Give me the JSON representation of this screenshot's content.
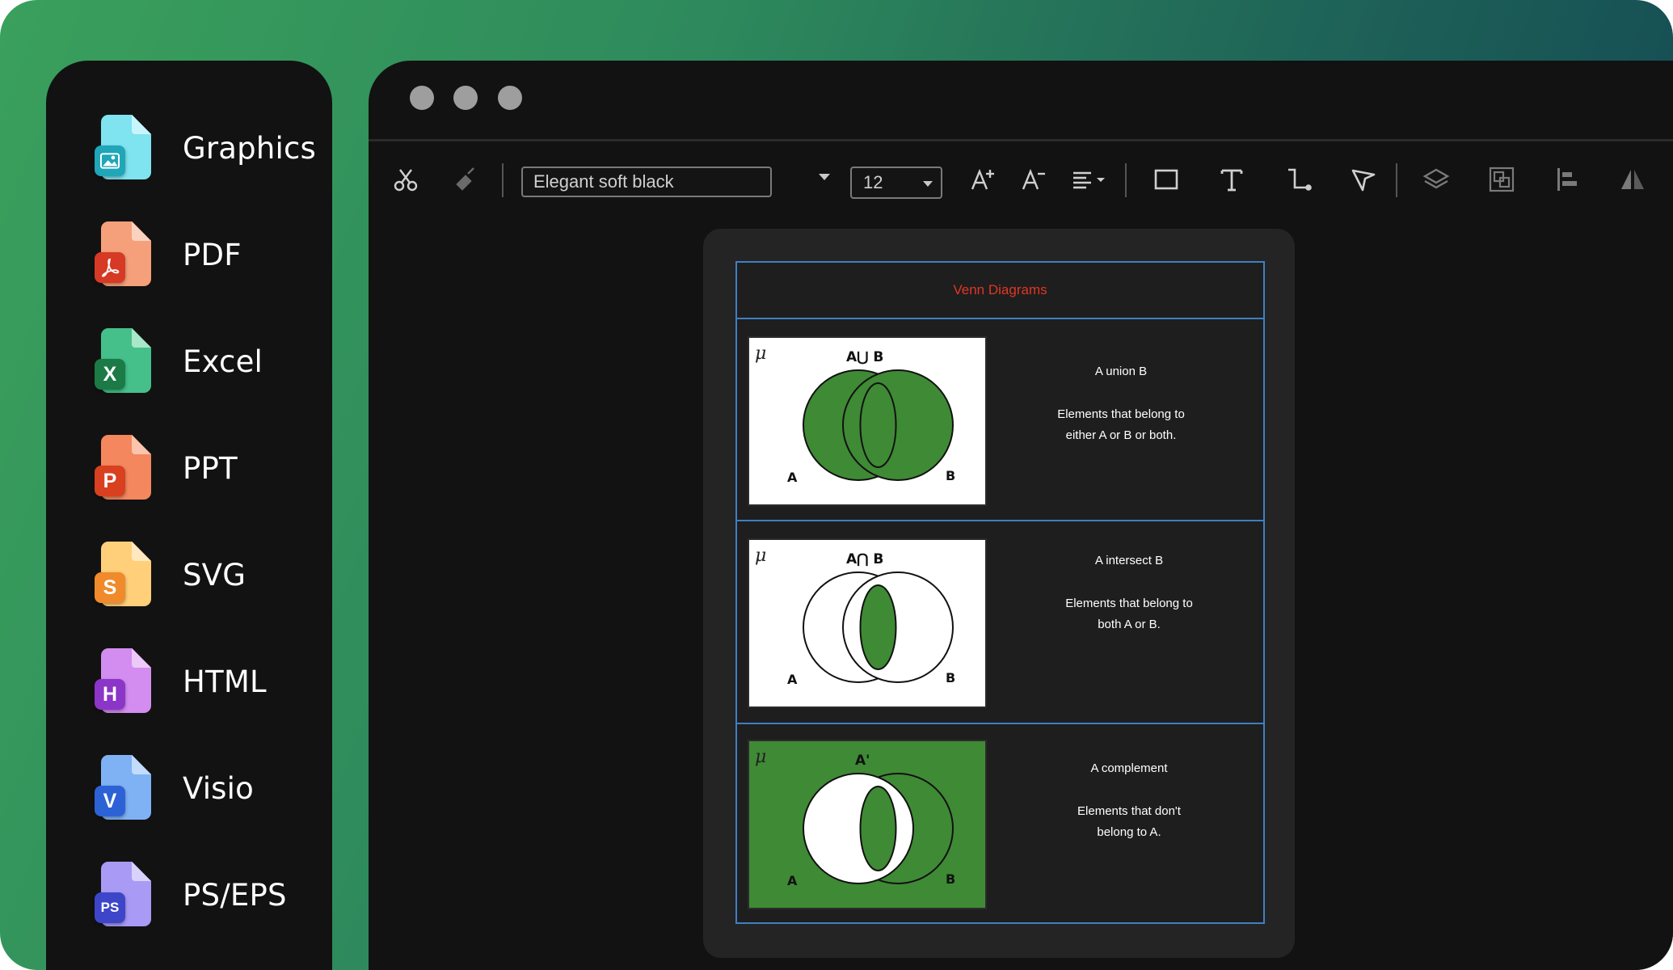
{
  "sidebar": {
    "items": [
      {
        "label": "Graphics",
        "badge": "",
        "icon": "image-file-icon",
        "sheet": "#7fe3f0",
        "fold": "#c8f5fb",
        "badge_color": "#1fa6b8"
      },
      {
        "label": "PDF",
        "badge": "",
        "icon": "pdf-file-icon",
        "sheet": "#f5a07a",
        "fold": "#fbd2bf",
        "badge_color": "#d63a24"
      },
      {
        "label": "Excel",
        "badge": "X",
        "icon": "excel-file-icon",
        "sheet": "#45c08a",
        "fold": "#a8e7c9",
        "badge_color": "#1b7a45"
      },
      {
        "label": "PPT",
        "badge": "P",
        "icon": "ppt-file-icon",
        "sheet": "#f4875e",
        "fold": "#fbc4ad",
        "badge_color": "#d9401f"
      },
      {
        "label": "SVG",
        "badge": "S",
        "icon": "svg-file-icon",
        "sheet": "#ffcf7a",
        "fold": "#ffe8bf",
        "badge_color": "#f08a2b"
      },
      {
        "label": "HTML",
        "badge": "H",
        "icon": "html-file-icon",
        "sheet": "#d38df0",
        "fold": "#edc9fa",
        "badge_color": "#8c35c9"
      },
      {
        "label": "Visio",
        "badge": "V",
        "icon": "visio-file-icon",
        "sheet": "#7fb2f5",
        "fold": "#c4dcfb",
        "badge_color": "#2d62d6"
      },
      {
        "label": "PS/EPS",
        "badge": "PS",
        "icon": "ps-eps-file-icon",
        "sheet": "#a99af5",
        "fold": "#d9d2fb",
        "badge_color": "#3d46c9"
      }
    ]
  },
  "toolbar": {
    "font_name": "Elegant soft black",
    "font_size": "12",
    "icons": [
      "cut-icon",
      "format-painter-icon",
      "increase-font-icon",
      "decrease-font-icon",
      "align-icon",
      "rectangle-icon",
      "text-icon",
      "connector-icon",
      "pointer-icon",
      "layers-icon",
      "group-icon",
      "align-left-icon",
      "flip-icon"
    ]
  },
  "diagram": {
    "title": "Venn Diagrams",
    "rows": [
      {
        "symbol": "μ",
        "set_label": "A⋃ B",
        "a": "A",
        "b": "B",
        "name": "A union B",
        "desc1": "Elements that belong to",
        "desc2": "either A or B or both."
      },
      {
        "symbol": "μ",
        "set_label": "A⋂ B",
        "a": "A",
        "b": "B",
        "name": "A intersect B",
        "desc1": "Elements that belong to",
        "desc2": "both A or B."
      },
      {
        "symbol": "μ",
        "set_label": "A'",
        "a": "A",
        "b": "B",
        "name": "A complement",
        "desc1": "Elements that don't",
        "desc2": "belong to A."
      }
    ]
  },
  "colors": {
    "venn_green": "#3f8a35",
    "table_border": "#3f7fc4",
    "title_red": "#e03626"
  }
}
